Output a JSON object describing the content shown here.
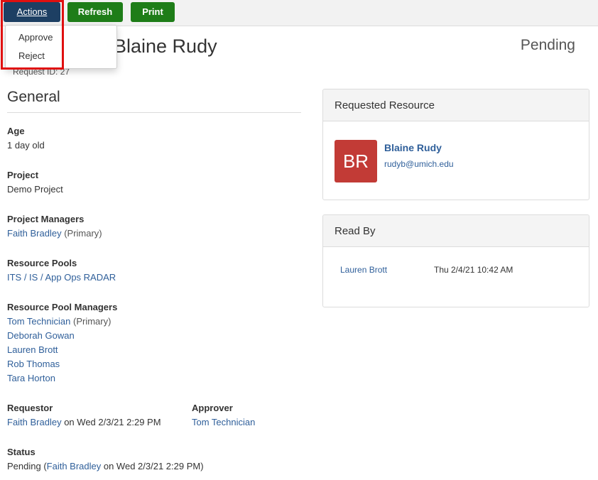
{
  "toolbar": {
    "actions_label": "Actions",
    "refresh_label": "Refresh",
    "print_label": "Print"
  },
  "actions_menu": {
    "items": [
      {
        "label": "Approve"
      },
      {
        "label": "Reject"
      }
    ]
  },
  "header": {
    "title": "Blaine Rudy",
    "request_id": "Request ID: 27",
    "status": "Pending"
  },
  "general": {
    "section_title": "General",
    "age": {
      "label": "Age",
      "value": "1 day old"
    },
    "project": {
      "label": "Project",
      "value": "Demo Project"
    },
    "project_managers": {
      "label": "Project Managers",
      "items": [
        {
          "name": "Faith Bradley",
          "suffix": " (Primary)"
        }
      ]
    },
    "resource_pools": {
      "label": "Resource Pools",
      "value": "ITS / IS / App Ops RADAR"
    },
    "resource_pool_managers": {
      "label": "Resource Pool Managers",
      "items": [
        {
          "name": "Tom Technician",
          "suffix": " (Primary)"
        },
        {
          "name": "Deborah Gowan",
          "suffix": ""
        },
        {
          "name": "Lauren Brott",
          "suffix": ""
        },
        {
          "name": "Rob Thomas",
          "suffix": ""
        },
        {
          "name": "Tara Horton",
          "suffix": ""
        }
      ]
    },
    "requestor": {
      "label": "Requestor",
      "name": "Faith Bradley",
      "on_text": " on Wed 2/3/21 2:29 PM"
    },
    "approver": {
      "label": "Approver",
      "name": "Tom Technician"
    },
    "status": {
      "label": "Status",
      "prefix": "Pending (",
      "name": "Faith Bradley",
      "suffix": " on Wed 2/3/21 2:29 PM)"
    }
  },
  "requested_resource": {
    "title": "Requested Resource",
    "initials": "BR",
    "avatar_color": "#c23b36",
    "name": "Blaine Rudy",
    "email": "rudyb@umich.edu"
  },
  "read_by": {
    "title": "Read By",
    "entries": [
      {
        "name": "Lauren Brott",
        "time": "Thu 2/4/21 10:42 AM"
      }
    ]
  }
}
